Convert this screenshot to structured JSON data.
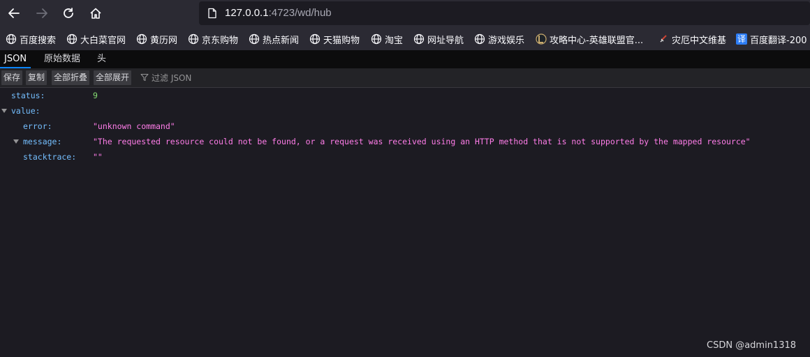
{
  "browser": {
    "url_host": "127.0.0.1",
    "url_rest": ":4723/wd/hub"
  },
  "bookmarks": [
    {
      "label": "百度搜索",
      "icon": "globe-icon"
    },
    {
      "label": "大白菜官网",
      "icon": "globe-icon"
    },
    {
      "label": "黄历网",
      "icon": "globe-icon"
    },
    {
      "label": "京东购物",
      "icon": "globe-icon"
    },
    {
      "label": "热点新闻",
      "icon": "globe-icon"
    },
    {
      "label": "天猫购物",
      "icon": "globe-icon"
    },
    {
      "label": "淘宝",
      "icon": "globe-icon"
    },
    {
      "label": "网址导航",
      "icon": "globe-icon"
    },
    {
      "label": "游戏娱乐",
      "icon": "globe-icon"
    },
    {
      "label": "攻略中心-英雄联盟官...",
      "icon": "league-logo-icon"
    },
    {
      "label": "灾厄中文维基",
      "icon": "sword-icon"
    },
    {
      "label": "百度翻译-200",
      "icon": "translate-icon",
      "icon_text": "译"
    }
  ],
  "viewer_tabs": [
    "JSON",
    "原始数据",
    "头"
  ],
  "json_toolbar": {
    "buttons": [
      "保存",
      "复制",
      "全部折叠",
      "全部展开"
    ],
    "filter_placeholder": "过滤 JSON"
  },
  "json_tree": {
    "status_key": "status:",
    "status_value": "9",
    "value_key": "value:",
    "error_key": "error:",
    "error_value": "\"unknown command\"",
    "message_key": "message:",
    "message_value": "\"The requested resource could not be found, or a request was received using an HTTP method that is not supported by the mapped resource\"",
    "stacktrace_key": "stacktrace:",
    "stacktrace_value": "\"\""
  },
  "watermark": "CSDN @admin1318",
  "colors": {
    "key": "#75bfff",
    "string": "#ff7de9",
    "number": "#86de74",
    "tab_accent": "#0a84ff"
  }
}
